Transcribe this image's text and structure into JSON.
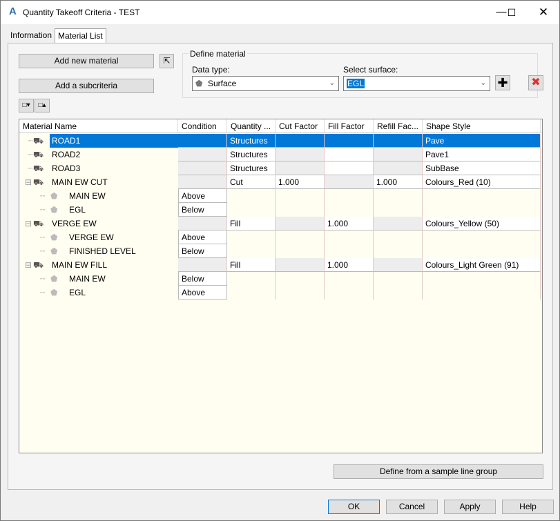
{
  "window": {
    "title": "Quantity Takeoff Criteria - TEST",
    "logo": "A"
  },
  "tabs": [
    {
      "label": "Information"
    },
    {
      "label": "Material List",
      "active": true
    }
  ],
  "toolbar": {
    "add_material": "Add new material",
    "add_subcriteria": "Add a subcriteria"
  },
  "define": {
    "group_label": "Define material",
    "data_type_label": "Data type:",
    "data_type_value": "Surface",
    "surface_label": "Select surface:",
    "surface_value": "EGL"
  },
  "table": {
    "columns": [
      "Material Name",
      "Condition",
      "Quantity ...",
      "Cut Factor",
      "Fill Factor",
      "Refill Fac...",
      "Shape Style"
    ],
    "rows": [
      {
        "level": 0,
        "name": "ROAD1",
        "condition": "",
        "quantity": "Structures",
        "cut": "",
        "fill": "",
        "refill": "",
        "shape": "Pave",
        "selected": true
      },
      {
        "level": 0,
        "name": "ROAD2",
        "condition": "",
        "quantity": "Structures",
        "cut": "",
        "fill": "",
        "refill": "",
        "shape": "Pave1"
      },
      {
        "level": 0,
        "name": "ROAD3",
        "condition": "",
        "quantity": "Structures",
        "cut": "",
        "fill": "",
        "refill": "",
        "shape": "SubBase"
      },
      {
        "level": 0,
        "name": "MAIN EW CUT",
        "condition": "",
        "quantity": "Cut",
        "cut": "1.000",
        "fill": "",
        "refill": "1.000",
        "shape": "Colours_Red (10)",
        "expanded": true
      },
      {
        "level": 1,
        "name": "MAIN EW",
        "condition": "Above"
      },
      {
        "level": 1,
        "name": "EGL",
        "condition": "Below"
      },
      {
        "level": 0,
        "name": "VERGE EW",
        "condition": "",
        "quantity": "Fill",
        "cut": "",
        "fill": "1.000",
        "refill": "",
        "shape": "Colours_Yellow (50)",
        "expanded": true
      },
      {
        "level": 1,
        "name": "VERGE EW",
        "condition": "Above"
      },
      {
        "level": 1,
        "name": "FINISHED LEVEL",
        "condition": "Below"
      },
      {
        "level": 0,
        "name": "MAIN EW FILL",
        "condition": "",
        "quantity": "Fill",
        "cut": "",
        "fill": "1.000",
        "refill": "",
        "shape": "Colours_Light Green (91)",
        "expanded": true
      },
      {
        "level": 1,
        "name": "MAIN EW",
        "condition": "Below"
      },
      {
        "level": 1,
        "name": "EGL",
        "condition": "Above"
      }
    ]
  },
  "buttons": {
    "define_sample": "Define from a sample line group",
    "ok": "OK",
    "cancel": "Cancel",
    "apply": "Apply",
    "help": "Help"
  },
  "colors": {
    "selection": "#0078d7",
    "child_row_bg": "#fffef0",
    "delete": "#e03030"
  }
}
